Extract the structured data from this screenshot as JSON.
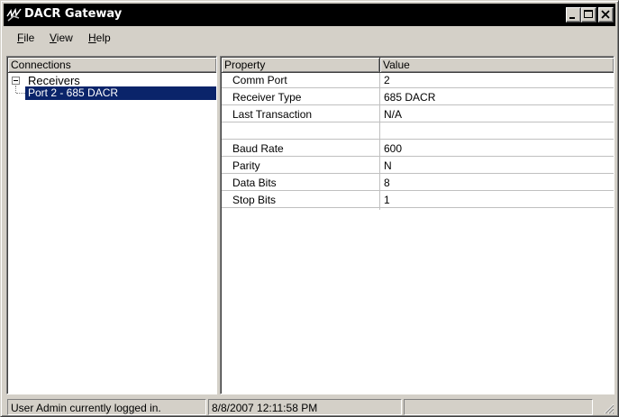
{
  "window": {
    "title": "DACR Gateway"
  },
  "menu": {
    "file": {
      "accel": "F",
      "rest": "ile"
    },
    "view": {
      "accel": "V",
      "rest": "iew"
    },
    "help": {
      "accel": "H",
      "rest": "elp"
    }
  },
  "tree": {
    "header": "Connections",
    "root": {
      "label": "Receivers",
      "expanded": true
    },
    "children": [
      {
        "label": "Port 2 - 685 DACR",
        "selected": true
      }
    ]
  },
  "properties": {
    "columns": [
      "Property",
      "Value"
    ],
    "rows": [
      {
        "property": "Comm Port",
        "value": "2"
      },
      {
        "property": "Receiver Type",
        "value": "685 DACR"
      },
      {
        "property": "Last Transaction",
        "value": "N/A"
      },
      {
        "property": "",
        "value": ""
      },
      {
        "property": "Baud Rate",
        "value": "600"
      },
      {
        "property": "Parity",
        "value": "N"
      },
      {
        "property": "Data Bits",
        "value": "8"
      },
      {
        "property": "Stop Bits",
        "value": "1"
      }
    ]
  },
  "status": {
    "user": "User Admin currently logged in.",
    "datetime": "8/8/2007 12:11:58 PM",
    "extra": ""
  },
  "icons": {
    "app": "signal-icon",
    "minimize": "minimize-icon",
    "maximize": "maximize-icon",
    "close": "close-icon",
    "expander": "tree-collapse-icon",
    "grip": "resize-grip-icon"
  },
  "colors": {
    "titlebar": "#000000",
    "selection": "#0a246a",
    "face": "#d4d0c8"
  }
}
